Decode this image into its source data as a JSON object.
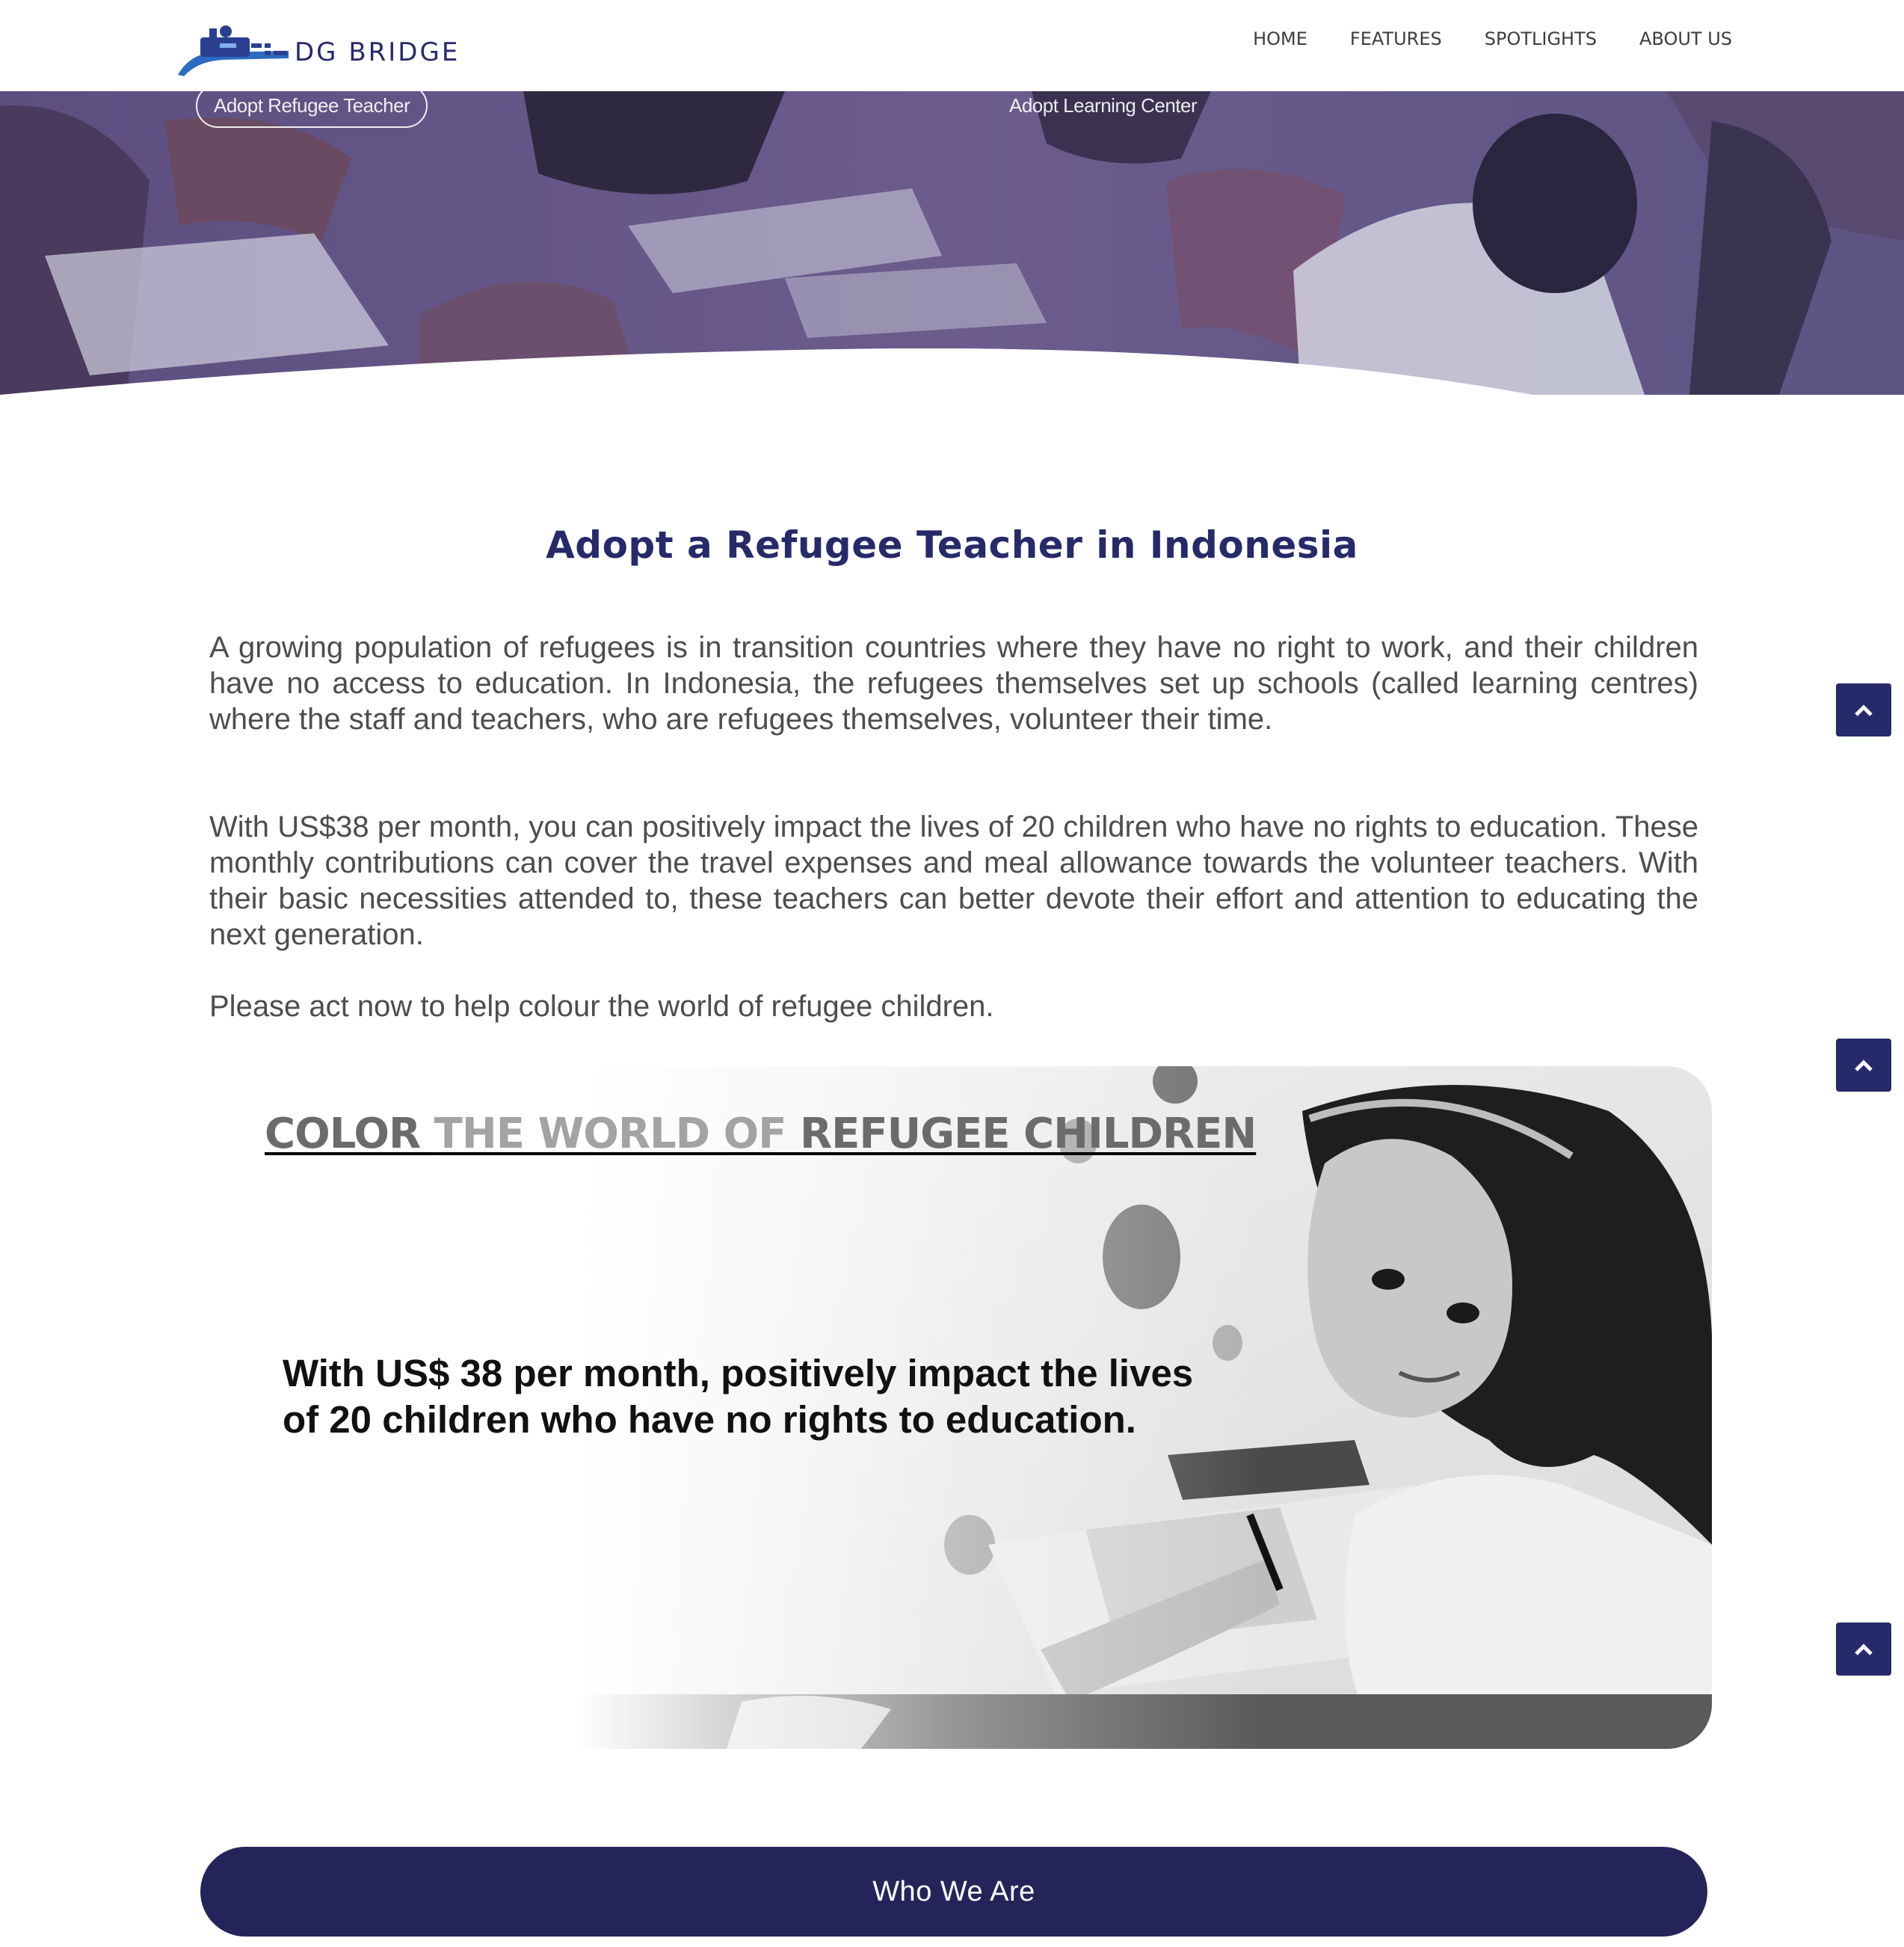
{
  "brand": {
    "name": "DG BRIDGE",
    "logo_icon": "bridge-train-logo"
  },
  "nav": {
    "items": [
      "HOME",
      "FEATURES",
      "SPOTLIGHTS",
      "ABOUT US"
    ]
  },
  "hero": {
    "tag_left": "Adopt Refugee Teacher",
    "tag_right": "Adopt Learning Center"
  },
  "main": {
    "title": "Adopt a Refugee Teacher in Indonesia",
    "paragraphs": [
      "A growing population of refugees is in transition countries where they have no right to work, and their children have no access to education. In Indonesia, the refugees themselves set up schools (called learning centres) where the staff and teachers, who are refugees themselves, volunteer their time.",
      "With US$38 per month, you can positively impact the lives of 20 children who have no rights to education. These monthly contributions can cover the travel expenses and meal allowance towards the volunteer teachers. With their basic necessities attended to, these teachers can better devote their effort and attention to educating the next generation.",
      "Please act now to help colour the world of refugee children."
    ]
  },
  "banner": {
    "heading_part1": "COLOR ",
    "heading_part2": "THE WORLD OF ",
    "heading_part3": "REFUGEE CHILDREN",
    "text": "With US$ 38 per month, positively impact the lives\n of 20 children who have no rights to education."
  },
  "side_buttons": {
    "icon": "chevron-up-icon"
  },
  "cta": {
    "label": "Who We Are"
  },
  "colors": {
    "brand_navy": "#262a6a",
    "button_navy": "#25245a",
    "text_gray": "#4d4d4d"
  }
}
